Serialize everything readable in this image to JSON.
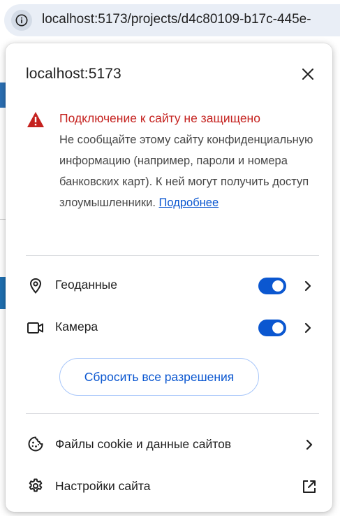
{
  "browser": {
    "url": "localhost:5173/projects/d4c80109-b17c-445e-",
    "site_info_icon": "info-icon"
  },
  "popup": {
    "title": "localhost:5173",
    "close_icon": "close-icon",
    "warning": {
      "icon": "warning-triangle-icon",
      "title": "Подключение к сайту не защищено",
      "body": "Не сообщайте этому сайту конфиденциальную информацию (например, пароли и номера банковских карт). К ней могут получить доступ злоумышленники.",
      "link": "Подробнее",
      "title_color": "#c5221f",
      "link_color": "#0b57d0"
    },
    "permissions": [
      {
        "label": "Геоданные",
        "icon": "location-pin-icon",
        "enabled": true
      },
      {
        "label": "Камера",
        "icon": "video-camera-icon",
        "enabled": true
      }
    ],
    "reset_button": "Сбросить все разрешения",
    "links": [
      {
        "label": "Файлы cookie и данные сайтов",
        "icon": "cookie-icon",
        "trailing_icon": "chevron-right-icon"
      },
      {
        "label": "Настройки сайта",
        "icon": "gear-icon",
        "trailing_icon": "open-in-new-icon"
      }
    ],
    "accent_color": "#0b57d0"
  }
}
